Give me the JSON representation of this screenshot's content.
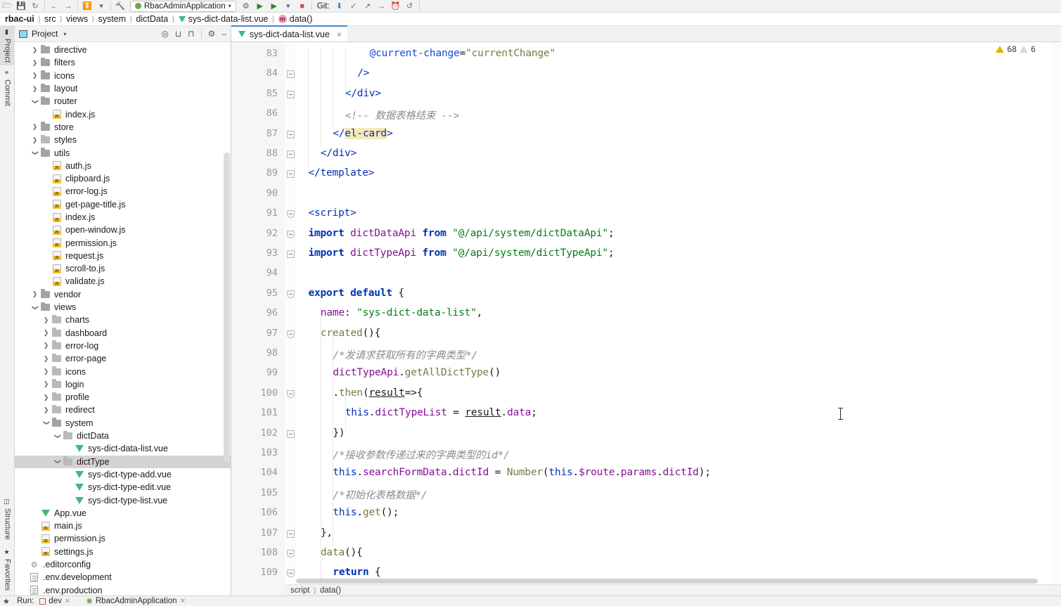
{
  "toolbar": {
    "icons": [
      "open-folder-icon",
      "save-icon",
      "sync-icon",
      "undo-icon",
      "redo-icon",
      "vcs-update-icon",
      "build-icon",
      "run-config-icon",
      "debug-icon",
      "run-icon",
      "coverage-icon",
      "dropdown-icon",
      "stop-icon"
    ],
    "run_config": "RbacAdminApplication",
    "git_label": "Git:",
    "git_icons": [
      "pull-icon",
      "commit-check-icon",
      "push-arrow-icon",
      "rollback-icon",
      "history-icon",
      "revert-icon"
    ]
  },
  "breadcrumb": {
    "items": [
      {
        "label": "rbac-ui",
        "icon": "",
        "bold": true
      },
      {
        "label": "src",
        "icon": "",
        "bold": false
      },
      {
        "label": "views",
        "icon": "",
        "bold": false
      },
      {
        "label": "system",
        "icon": "",
        "bold": false
      },
      {
        "label": "dictData",
        "icon": "",
        "bold": false
      },
      {
        "label": "sys-dict-data-list.vue",
        "icon": "vue-file-icon",
        "bold": false
      },
      {
        "label": "data()",
        "icon": "method-icon",
        "bold": false
      }
    ]
  },
  "left_strip": {
    "top_tabs": [
      {
        "label": "Project",
        "icon": "project-icon",
        "selected": true
      },
      {
        "label": "Commit",
        "icon": "commit-icon",
        "selected": false
      }
    ],
    "bottom_tabs": [
      {
        "label": "Structure",
        "icon": "structure-icon"
      },
      {
        "label": "Favorites",
        "icon": "favorites-icon"
      }
    ]
  },
  "project_panel": {
    "title": "Project",
    "actions": [
      "locate-icon",
      "expand-all-icon",
      "collapse-all-icon",
      "settings-icon",
      "hide-icon"
    ],
    "tree": [
      {
        "indent": 1,
        "arrow": "right",
        "icon": "folder",
        "label": "directive"
      },
      {
        "indent": 1,
        "arrow": "right",
        "icon": "folder",
        "label": "filters"
      },
      {
        "indent": 1,
        "arrow": "right",
        "icon": "folder",
        "label": "icons"
      },
      {
        "indent": 1,
        "arrow": "right",
        "icon": "folder",
        "label": "layout"
      },
      {
        "indent": 1,
        "arrow": "down",
        "icon": "folder",
        "label": "router"
      },
      {
        "indent": 2,
        "arrow": "none",
        "icon": "js",
        "label": "index.js"
      },
      {
        "indent": 1,
        "arrow": "right",
        "icon": "folder",
        "label": "store"
      },
      {
        "indent": 1,
        "arrow": "right",
        "icon": "folder-light",
        "label": "styles"
      },
      {
        "indent": 1,
        "arrow": "down",
        "icon": "folder",
        "label": "utils"
      },
      {
        "indent": 2,
        "arrow": "none",
        "icon": "js",
        "label": "auth.js"
      },
      {
        "indent": 2,
        "arrow": "none",
        "icon": "js",
        "label": "clipboard.js"
      },
      {
        "indent": 2,
        "arrow": "none",
        "icon": "js",
        "label": "error-log.js"
      },
      {
        "indent": 2,
        "arrow": "none",
        "icon": "js",
        "label": "get-page-title.js"
      },
      {
        "indent": 2,
        "arrow": "none",
        "icon": "js",
        "label": "index.js"
      },
      {
        "indent": 2,
        "arrow": "none",
        "icon": "js",
        "label": "open-window.js"
      },
      {
        "indent": 2,
        "arrow": "none",
        "icon": "js",
        "label": "permission.js"
      },
      {
        "indent": 2,
        "arrow": "none",
        "icon": "js",
        "label": "request.js"
      },
      {
        "indent": 2,
        "arrow": "none",
        "icon": "js",
        "label": "scroll-to.js"
      },
      {
        "indent": 2,
        "arrow": "none",
        "icon": "js",
        "label": "validate.js"
      },
      {
        "indent": 1,
        "arrow": "right",
        "icon": "folder",
        "label": "vendor"
      },
      {
        "indent": 1,
        "arrow": "down",
        "icon": "folder",
        "label": "views"
      },
      {
        "indent": 2,
        "arrow": "right",
        "icon": "folder-light",
        "label": "charts"
      },
      {
        "indent": 2,
        "arrow": "right",
        "icon": "folder-light",
        "label": "dashboard"
      },
      {
        "indent": 2,
        "arrow": "right",
        "icon": "folder-light",
        "label": "error-log"
      },
      {
        "indent": 2,
        "arrow": "right",
        "icon": "folder-light",
        "label": "error-page"
      },
      {
        "indent": 2,
        "arrow": "right",
        "icon": "folder-light",
        "label": "icons"
      },
      {
        "indent": 2,
        "arrow": "right",
        "icon": "folder-light",
        "label": "login"
      },
      {
        "indent": 2,
        "arrow": "right",
        "icon": "folder-light",
        "label": "profile"
      },
      {
        "indent": 2,
        "arrow": "right",
        "icon": "folder-light",
        "label": "redirect"
      },
      {
        "indent": 2,
        "arrow": "down",
        "icon": "folder",
        "label": "system"
      },
      {
        "indent": 3,
        "arrow": "down",
        "icon": "folder-light",
        "label": "dictData"
      },
      {
        "indent": 4,
        "arrow": "none",
        "icon": "vue",
        "label": "sys-dict-data-list.vue"
      },
      {
        "indent": 3,
        "arrow": "down",
        "icon": "folder-light",
        "label": "dictType",
        "selected": true
      },
      {
        "indent": 4,
        "arrow": "none",
        "icon": "vue",
        "label": "sys-dict-type-add.vue"
      },
      {
        "indent": 4,
        "arrow": "none",
        "icon": "vue",
        "label": "sys-dict-type-edit.vue"
      },
      {
        "indent": 4,
        "arrow": "none",
        "icon": "vue",
        "label": "sys-dict-type-list.vue"
      },
      {
        "indent": 1,
        "arrow": "none",
        "icon": "vue",
        "label": "App.vue"
      },
      {
        "indent": 1,
        "arrow": "none",
        "icon": "js",
        "label": "main.js"
      },
      {
        "indent": 1,
        "arrow": "none",
        "icon": "js",
        "label": "permission.js"
      },
      {
        "indent": 1,
        "arrow": "none",
        "icon": "js",
        "label": "settings.js"
      },
      {
        "indent": 0,
        "arrow": "none",
        "icon": "gear",
        "label": ".editorconfig"
      },
      {
        "indent": 0,
        "arrow": "none",
        "icon": "doc",
        "label": ".env.development"
      },
      {
        "indent": 0,
        "arrow": "none",
        "icon": "doc",
        "label": ".env.production"
      }
    ]
  },
  "editor": {
    "tab": {
      "label": "sys-dict-data-list.vue",
      "icon": "vue-file-icon",
      "close": "×"
    },
    "warnings": {
      "error_count": "68",
      "warning_count": "6"
    },
    "status_breadcrumb": [
      "script",
      "data()"
    ],
    "first_line": 83,
    "lines": [
      {
        "n": 83,
        "indent": 12,
        "fold": "none",
        "tokens": [
          {
            "t": "@current-change",
            "c": "t-attr"
          },
          {
            "t": "=",
            "c": "t-plain"
          },
          {
            "t": "\"currentChange\"",
            "c": "t-val"
          }
        ]
      },
      {
        "n": 84,
        "indent": 10,
        "fold": "end",
        "tokens": [
          {
            "t": "/>",
            "c": "t-tag"
          }
        ]
      },
      {
        "n": 85,
        "indent": 8,
        "fold": "end",
        "tokens": [
          {
            "t": "</div>",
            "c": "t-tag"
          }
        ]
      },
      {
        "n": 86,
        "indent": 8,
        "fold": "none",
        "tokens": [
          {
            "t": "<!-- 数据表格结束 -->",
            "c": "t-cmt"
          }
        ]
      },
      {
        "n": 87,
        "indent": 6,
        "fold": "end",
        "tokens": [
          {
            "t": "</",
            "c": "t-tag"
          },
          {
            "t": "el-card",
            "c": "t-tag hl-el"
          },
          {
            "t": ">",
            "c": "t-tag"
          }
        ]
      },
      {
        "n": 88,
        "indent": 4,
        "fold": "end",
        "tokens": [
          {
            "t": "</div>",
            "c": "t-tag"
          }
        ]
      },
      {
        "n": 89,
        "indent": 2,
        "fold": "end",
        "tokens": [
          {
            "t": "</template>",
            "c": "t-tag"
          }
        ]
      },
      {
        "n": 90,
        "indent": 2,
        "fold": "none",
        "tokens": []
      },
      {
        "n": 91,
        "indent": 2,
        "fold": "start",
        "tokens": [
          {
            "t": "<script>",
            "c": "t-tag"
          }
        ]
      },
      {
        "n": 92,
        "indent": 2,
        "fold": "start",
        "tokens": [
          {
            "t": "import ",
            "c": "t-kw"
          },
          {
            "t": "dictDataApi",
            "c": "t-field"
          },
          {
            "t": " from ",
            "c": "t-kw"
          },
          {
            "t": "\"@/api/system/dictDataApi\"",
            "c": "t-str"
          },
          {
            "t": ";",
            "c": "t-plain"
          }
        ]
      },
      {
        "n": 93,
        "indent": 2,
        "fold": "end",
        "tokens": [
          {
            "t": "import ",
            "c": "t-kw"
          },
          {
            "t": "dictTypeApi",
            "c": "t-field"
          },
          {
            "t": " from ",
            "c": "t-kw"
          },
          {
            "t": "\"@/api/system/dictTypeApi\"",
            "c": "t-str"
          },
          {
            "t": ";",
            "c": "t-plain"
          }
        ]
      },
      {
        "n": 94,
        "indent": 2,
        "fold": "none",
        "tokens": []
      },
      {
        "n": 95,
        "indent": 2,
        "fold": "start",
        "tokens": [
          {
            "t": "export default",
            "c": "t-kw"
          },
          {
            "t": " {",
            "c": "t-plain"
          }
        ]
      },
      {
        "n": 96,
        "indent": 4,
        "fold": "none",
        "tokens": [
          {
            "t": "name",
            "c": "t-field"
          },
          {
            "t": ": ",
            "c": "t-plain"
          },
          {
            "t": "\"sys-dict-data-list\"",
            "c": "t-str"
          },
          {
            "t": ",",
            "c": "t-plain"
          }
        ]
      },
      {
        "n": 97,
        "indent": 4,
        "fold": "start",
        "tokens": [
          {
            "t": "created",
            "c": "t-fn"
          },
          {
            "t": "(){",
            "c": "t-plain"
          }
        ]
      },
      {
        "n": 98,
        "indent": 6,
        "fold": "none",
        "tokens": [
          {
            "t": "/*发请求获取所有的字典类型*/",
            "c": "t-cmt"
          }
        ]
      },
      {
        "n": 99,
        "indent": 6,
        "fold": "none",
        "tokens": [
          {
            "t": "dictTypeApi",
            "c": "t-field"
          },
          {
            "t": ".",
            "c": "t-plain"
          },
          {
            "t": "getAllDictType",
            "c": "t-fn"
          },
          {
            "t": "()",
            "c": "t-plain"
          }
        ]
      },
      {
        "n": 100,
        "indent": 6,
        "fold": "start",
        "tokens": [
          {
            "t": ".",
            "c": "t-plain"
          },
          {
            "t": "then",
            "c": "t-fn"
          },
          {
            "t": "(",
            "c": "t-plain"
          },
          {
            "t": "result",
            "c": "t-param"
          },
          {
            "t": "=>{",
            "c": "t-plain"
          }
        ]
      },
      {
        "n": 101,
        "indent": 8,
        "fold": "none",
        "tokens": [
          {
            "t": "this",
            "c": "t-this"
          },
          {
            "t": ".",
            "c": "t-plain"
          },
          {
            "t": "dictTypeList",
            "c": "t-field"
          },
          {
            "t": " = ",
            "c": "t-plain"
          },
          {
            "t": "result",
            "c": "t-param"
          },
          {
            "t": ".",
            "c": "t-plain"
          },
          {
            "t": "data",
            "c": "t-field"
          },
          {
            "t": ";",
            "c": "t-plain"
          }
        ]
      },
      {
        "n": 102,
        "indent": 6,
        "fold": "end",
        "tokens": [
          {
            "t": "})",
            "c": "t-plain"
          }
        ]
      },
      {
        "n": 103,
        "indent": 6,
        "fold": "none",
        "tokens": [
          {
            "t": "/*接收参数传递过来的字典类型的id*/",
            "c": "t-cmt"
          }
        ]
      },
      {
        "n": 104,
        "indent": 6,
        "fold": "none",
        "tokens": [
          {
            "t": "this",
            "c": "t-this"
          },
          {
            "t": ".",
            "c": "t-plain"
          },
          {
            "t": "searchFormData",
            "c": "t-field"
          },
          {
            "t": ".",
            "c": "t-plain"
          },
          {
            "t": "dictId",
            "c": "t-field"
          },
          {
            "t": " = ",
            "c": "t-plain"
          },
          {
            "t": "Number",
            "c": "t-fn"
          },
          {
            "t": "(",
            "c": "t-plain"
          },
          {
            "t": "this",
            "c": "t-this"
          },
          {
            "t": ".",
            "c": "t-plain"
          },
          {
            "t": "$route",
            "c": "t-field"
          },
          {
            "t": ".",
            "c": "t-plain"
          },
          {
            "t": "params",
            "c": "t-field"
          },
          {
            "t": ".",
            "c": "t-plain"
          },
          {
            "t": "dictId",
            "c": "t-field"
          },
          {
            "t": ");",
            "c": "t-plain"
          }
        ]
      },
      {
        "n": 105,
        "indent": 6,
        "fold": "none",
        "tokens": [
          {
            "t": "/*初始化表格数据*/",
            "c": "t-cmt"
          }
        ]
      },
      {
        "n": 106,
        "indent": 6,
        "fold": "none",
        "tokens": [
          {
            "t": "this",
            "c": "t-this"
          },
          {
            "t": ".",
            "c": "t-plain"
          },
          {
            "t": "get",
            "c": "t-fn"
          },
          {
            "t": "();",
            "c": "t-plain"
          }
        ]
      },
      {
        "n": 107,
        "indent": 4,
        "fold": "end",
        "tokens": [
          {
            "t": "},",
            "c": "t-plain"
          }
        ]
      },
      {
        "n": 108,
        "indent": 4,
        "fold": "start",
        "tokens": [
          {
            "t": "data",
            "c": "t-fn"
          },
          {
            "t": "(){",
            "c": "t-plain"
          }
        ]
      },
      {
        "n": 109,
        "indent": 6,
        "fold": "start",
        "tokens": [
          {
            "t": "return",
            "c": "t-kw"
          },
          {
            "t": " {",
            "c": "t-plain"
          }
        ]
      }
    ]
  },
  "run_bar": {
    "label": "Run:",
    "items": [
      {
        "label": "dev",
        "icon": "stop-square-icon"
      },
      {
        "label": "RbacAdminApplication",
        "icon": "spring-boot-icon"
      }
    ]
  },
  "colors": {
    "accent": "#4a86c8",
    "vue_green": "#3fb984",
    "warning_yellow": "#e8b300",
    "selection_gray": "#d4d4d4",
    "highlight_yellow": "#f6e9b8"
  }
}
